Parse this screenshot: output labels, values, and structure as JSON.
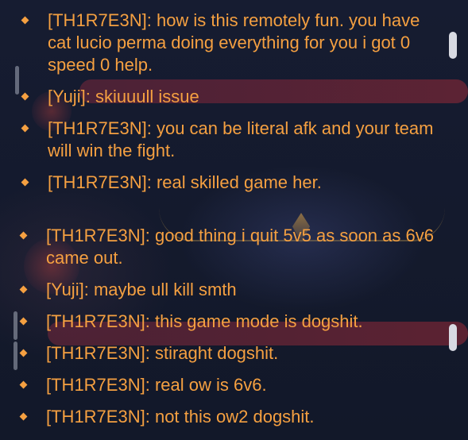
{
  "chat_top": [
    {
      "author": "[TH1R7E3N]",
      "text": "how is this remotely fun. you have cat lucio perma doing everything for you i got 0 speed 0 help."
    },
    {
      "author": "[Yuji]",
      "text": "skiuuull issue"
    },
    {
      "author": "[TH1R7E3N]",
      "text": "you can be literal afk and your team will win the fight."
    },
    {
      "author": "[TH1R7E3N]",
      "text": "real skilled game her."
    }
  ],
  "chat_bottom": [
    {
      "author": "[TH1R7E3N]",
      "text": "good thing i quit 5v5 as soon as 6v6 came out."
    },
    {
      "author": "[Yuji]",
      "text": "maybe ull kill smth"
    },
    {
      "author": "[TH1R7E3N]",
      "text": "this game mode is dogshit."
    },
    {
      "author": "[TH1R7E3N]",
      "text": "stiraght dogshit."
    },
    {
      "author": "[TH1R7E3N]",
      "text": "real ow is 6v6."
    },
    {
      "author": "[TH1R7E3N]",
      "text": "not this ow2 dogshit."
    }
  ],
  "colors": {
    "chat_text": "#f5a041",
    "background": "#141a2e",
    "scrollbar": "#d8dae2"
  }
}
